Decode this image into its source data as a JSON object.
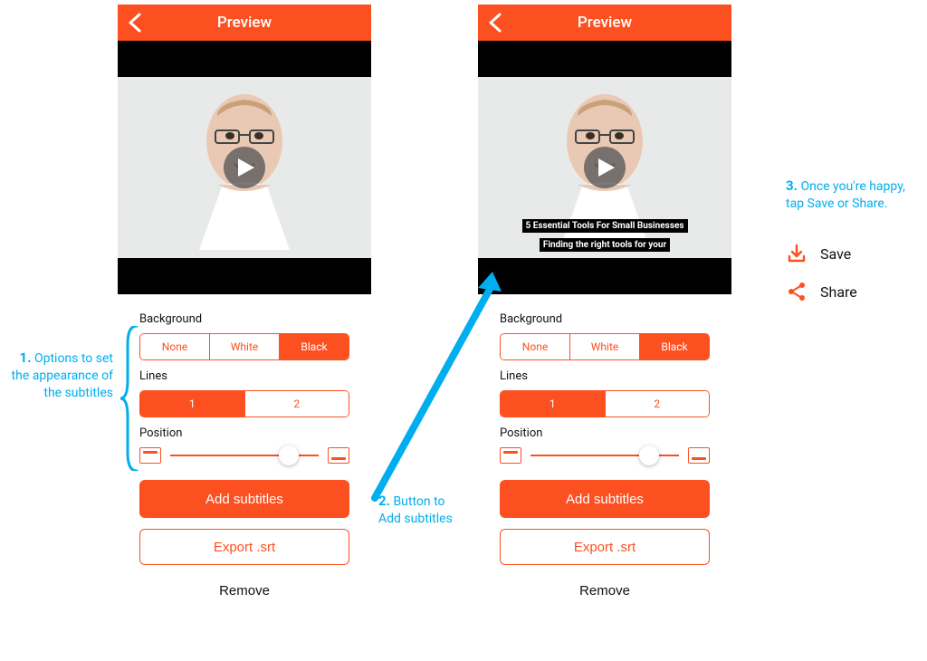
{
  "navbar": {
    "title": "Preview"
  },
  "options": {
    "background_label": "Background",
    "background_items": [
      "None",
      "White",
      "Black"
    ],
    "background_selected": "Black",
    "lines_label": "Lines",
    "lines_items": [
      "1",
      "2"
    ],
    "lines_selected": "1",
    "position_label": "Position",
    "position_value": 0.8
  },
  "buttons": {
    "add_subtitles": "Add subtitles",
    "export_srt": "Export .srt",
    "remove": "Remove"
  },
  "captions": {
    "line1": "5 Essential Tools For Small Businesses",
    "line2": "Finding the right tools for your"
  },
  "actions": {
    "save": "Save",
    "share": "Share"
  },
  "annotations": {
    "a1_num": "1.",
    "a1_text": "Options to set the appearance of the subtitles",
    "a2_num": "2.",
    "a2_text": "Button to Add subtitles",
    "a3_num": "3.",
    "a3_text": "Once you're happy, tap Save or Share."
  }
}
